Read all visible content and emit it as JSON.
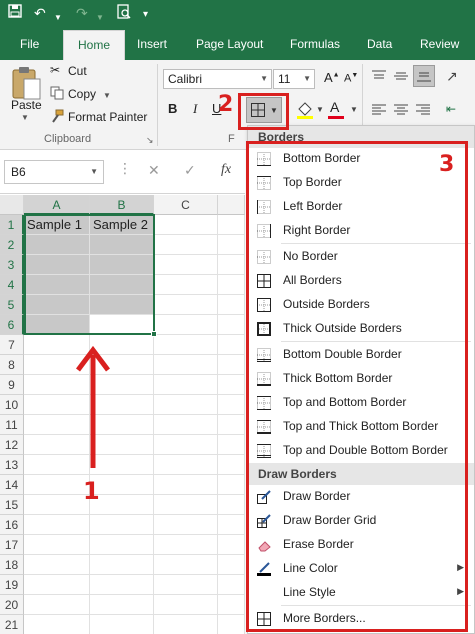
{
  "tabs": [
    "File",
    "Home",
    "Insert",
    "Page Layout",
    "Formulas",
    "Data",
    "Review"
  ],
  "clipboard": {
    "paste_label": "Paste",
    "cut_label": "Cut",
    "copy_label": "Copy",
    "format_painter_label": "Format Painter",
    "group_label": "Clipboard"
  },
  "font": {
    "name": "Calibri",
    "size": "11",
    "bold": "B",
    "italic": "I",
    "underline": "U",
    "group_label": "F"
  },
  "namebox": {
    "value": "B6"
  },
  "formula_bar": {
    "fx_label": "fx"
  },
  "grid": {
    "columns": [
      "A",
      "B",
      "C"
    ],
    "rows": [
      "1",
      "2",
      "3",
      "4",
      "5",
      "6",
      "7",
      "8",
      "9",
      "10",
      "11",
      "12",
      "13",
      "14",
      "15",
      "16",
      "17",
      "18",
      "19",
      "20",
      "21"
    ],
    "cells": {
      "A1": "Sample 1",
      "B1": "Sample 2"
    }
  },
  "borders_menu": {
    "header": "Borders",
    "draw_header": "Draw Borders",
    "items": [
      {
        "label": "Bottom Border",
        "icon": "bottom-border-icon"
      },
      {
        "label": "Top Border",
        "icon": "top-border-icon"
      },
      {
        "label": "Left Border",
        "icon": "left-border-icon"
      },
      {
        "label": "Right Border",
        "icon": "right-border-icon"
      },
      {
        "label": "No Border",
        "icon": "no-border-icon"
      },
      {
        "label": "All Borders",
        "icon": "all-borders-icon"
      },
      {
        "label": "Outside Borders",
        "icon": "outside-borders-icon"
      },
      {
        "label": "Thick Outside Borders",
        "icon": "thick-outside-borders-icon"
      },
      {
        "label": "Bottom Double Border",
        "icon": "bottom-double-border-icon"
      },
      {
        "label": "Thick Bottom Border",
        "icon": "thick-bottom-border-icon"
      },
      {
        "label": "Top and Bottom Border",
        "icon": "top-and-bottom-border-icon"
      },
      {
        "label": "Top and Thick Bottom Border",
        "icon": "top-thick-bottom-border-icon"
      },
      {
        "label": "Top and Double Bottom Border",
        "icon": "top-double-bottom-border-icon"
      }
    ],
    "draw_items": [
      {
        "label": "Draw Border",
        "icon": "draw-border-icon"
      },
      {
        "label": "Draw Border Grid",
        "icon": "draw-border-grid-icon"
      },
      {
        "label": "Erase Border",
        "icon": "eraser-icon"
      },
      {
        "label": "Line Color",
        "icon": "line-color-icon"
      },
      {
        "label": "Line Style",
        "icon": "line-style-icon"
      },
      {
        "label": "More Borders...",
        "icon": "more-borders-icon"
      }
    ]
  },
  "annotations": {
    "step1": "1",
    "step2": "2",
    "step3": "3"
  },
  "colors": {
    "excel_green": "#217346",
    "annotation_red": "#d9201f",
    "selection_fill": "#c8c8c8"
  }
}
